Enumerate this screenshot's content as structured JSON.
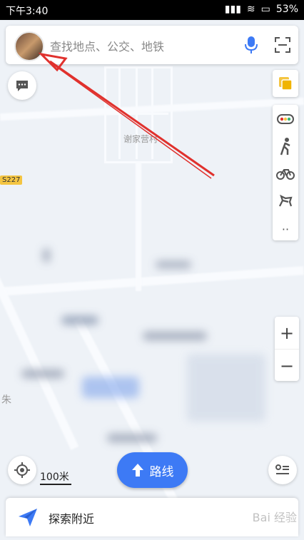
{
  "status": {
    "time": "下午3:40",
    "battery": "53%"
  },
  "search": {
    "placeholder": "查找地点、公交、地铁"
  },
  "map": {
    "labels": {
      "village": "谢家营村",
      "road_badge": "S227",
      "west_edge_char": "朱"
    }
  },
  "scale": {
    "text": "100米"
  },
  "route_button": {
    "label": "路线"
  },
  "bottom_bar": {
    "label": "探索附近"
  },
  "watermark": "Bai 经验",
  "colors": {
    "accent": "#3d7af5",
    "traffic_yellow": "#f4c542",
    "annotation_red": "#e0312d"
  },
  "icons": [
    "avatar",
    "microphone-icon",
    "scan-icon",
    "message-icon",
    "layers-icon",
    "traffic-icon",
    "walk-icon",
    "bike-icon",
    "more-icon",
    "zoom-in-icon",
    "zoom-out-icon",
    "locate-icon",
    "list-icon",
    "route-arrow-icon",
    "send-icon"
  ]
}
